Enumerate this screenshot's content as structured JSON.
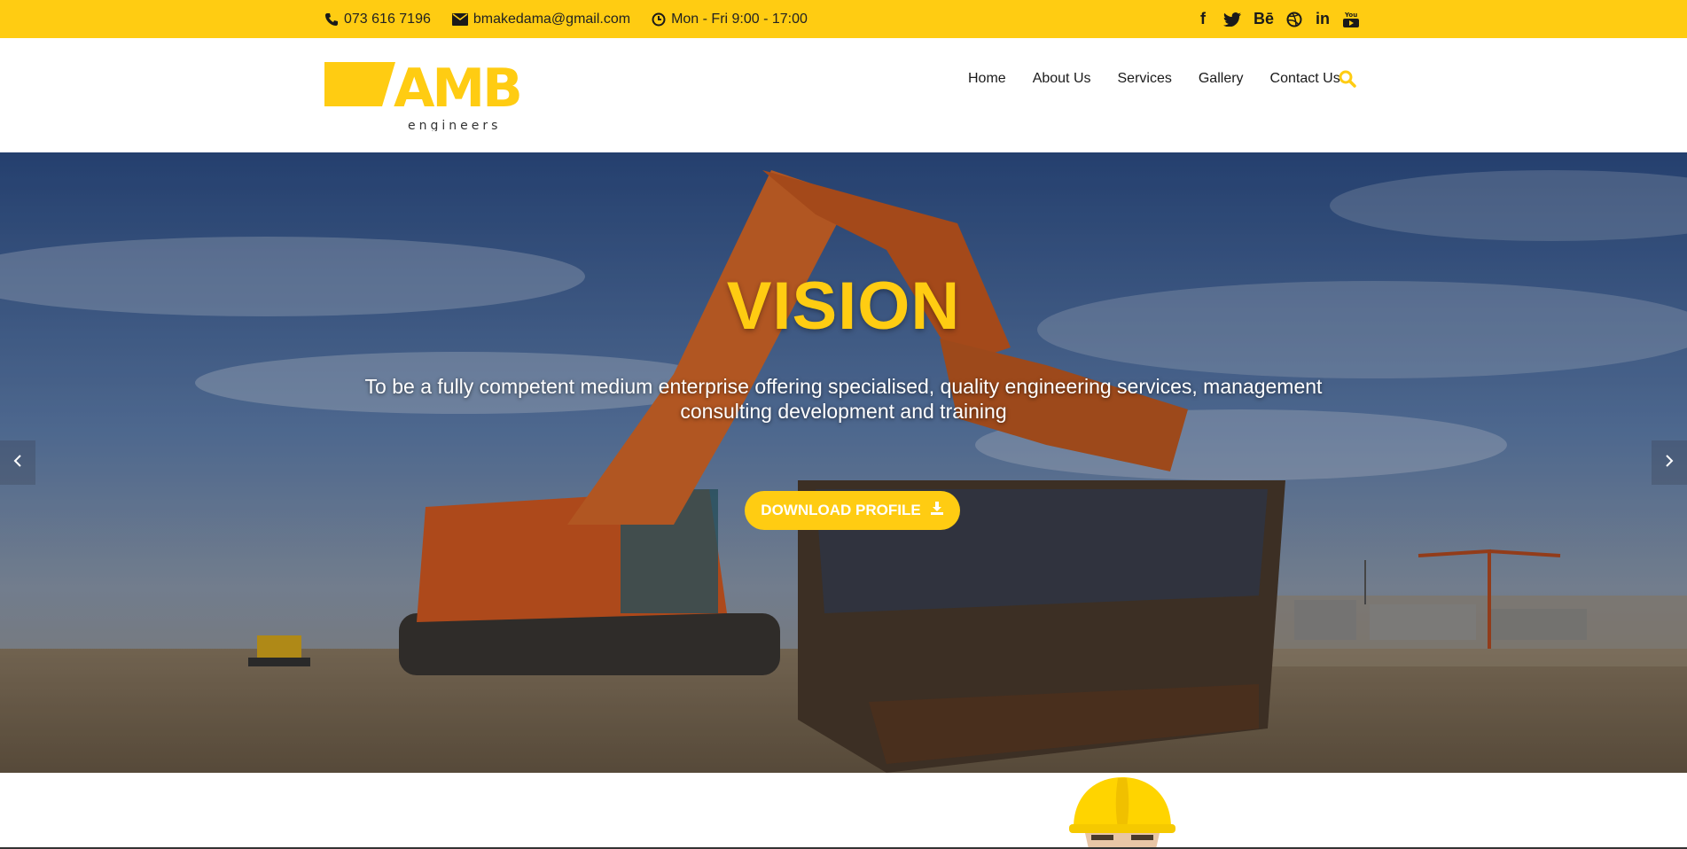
{
  "topbar": {
    "phone": "073 616 7196",
    "email": "bmakedama@gmail.com",
    "hours": "Mon - Fri 9:00 - 17:00",
    "social": [
      {
        "icon": "facebook-icon",
        "glyph": "f"
      },
      {
        "icon": "twitter-icon",
        "glyph": ""
      },
      {
        "icon": "behance-icon",
        "glyph": "Bē"
      },
      {
        "icon": "dribbble-icon",
        "glyph": ""
      },
      {
        "icon": "linkedin-icon",
        "glyph": "in"
      },
      {
        "icon": "youtube-icon",
        "glyph": ""
      }
    ],
    "bg_color": "#ffcc12"
  },
  "header": {
    "logo_text": "AMB",
    "logo_sub": "engineers",
    "nav": [
      {
        "label": "Home"
      },
      {
        "label": "About Us"
      },
      {
        "label": "Services"
      },
      {
        "label": "Gallery"
      },
      {
        "label": "Contact Us"
      }
    ],
    "search_icon": "search-icon"
  },
  "hero": {
    "title": "VISION",
    "text": "To be a fully competent medium enterprise offering specialised, quality engineering services, management consulting development and training",
    "cta_label": "DOWNLOAD PROFILE",
    "cta_icon": "download-icon",
    "prev_icon": "chevron-left-icon",
    "next_icon": "chevron-right-icon"
  },
  "colors": {
    "accent": "#ffcc12",
    "text_dark": "#1a1a1a"
  }
}
